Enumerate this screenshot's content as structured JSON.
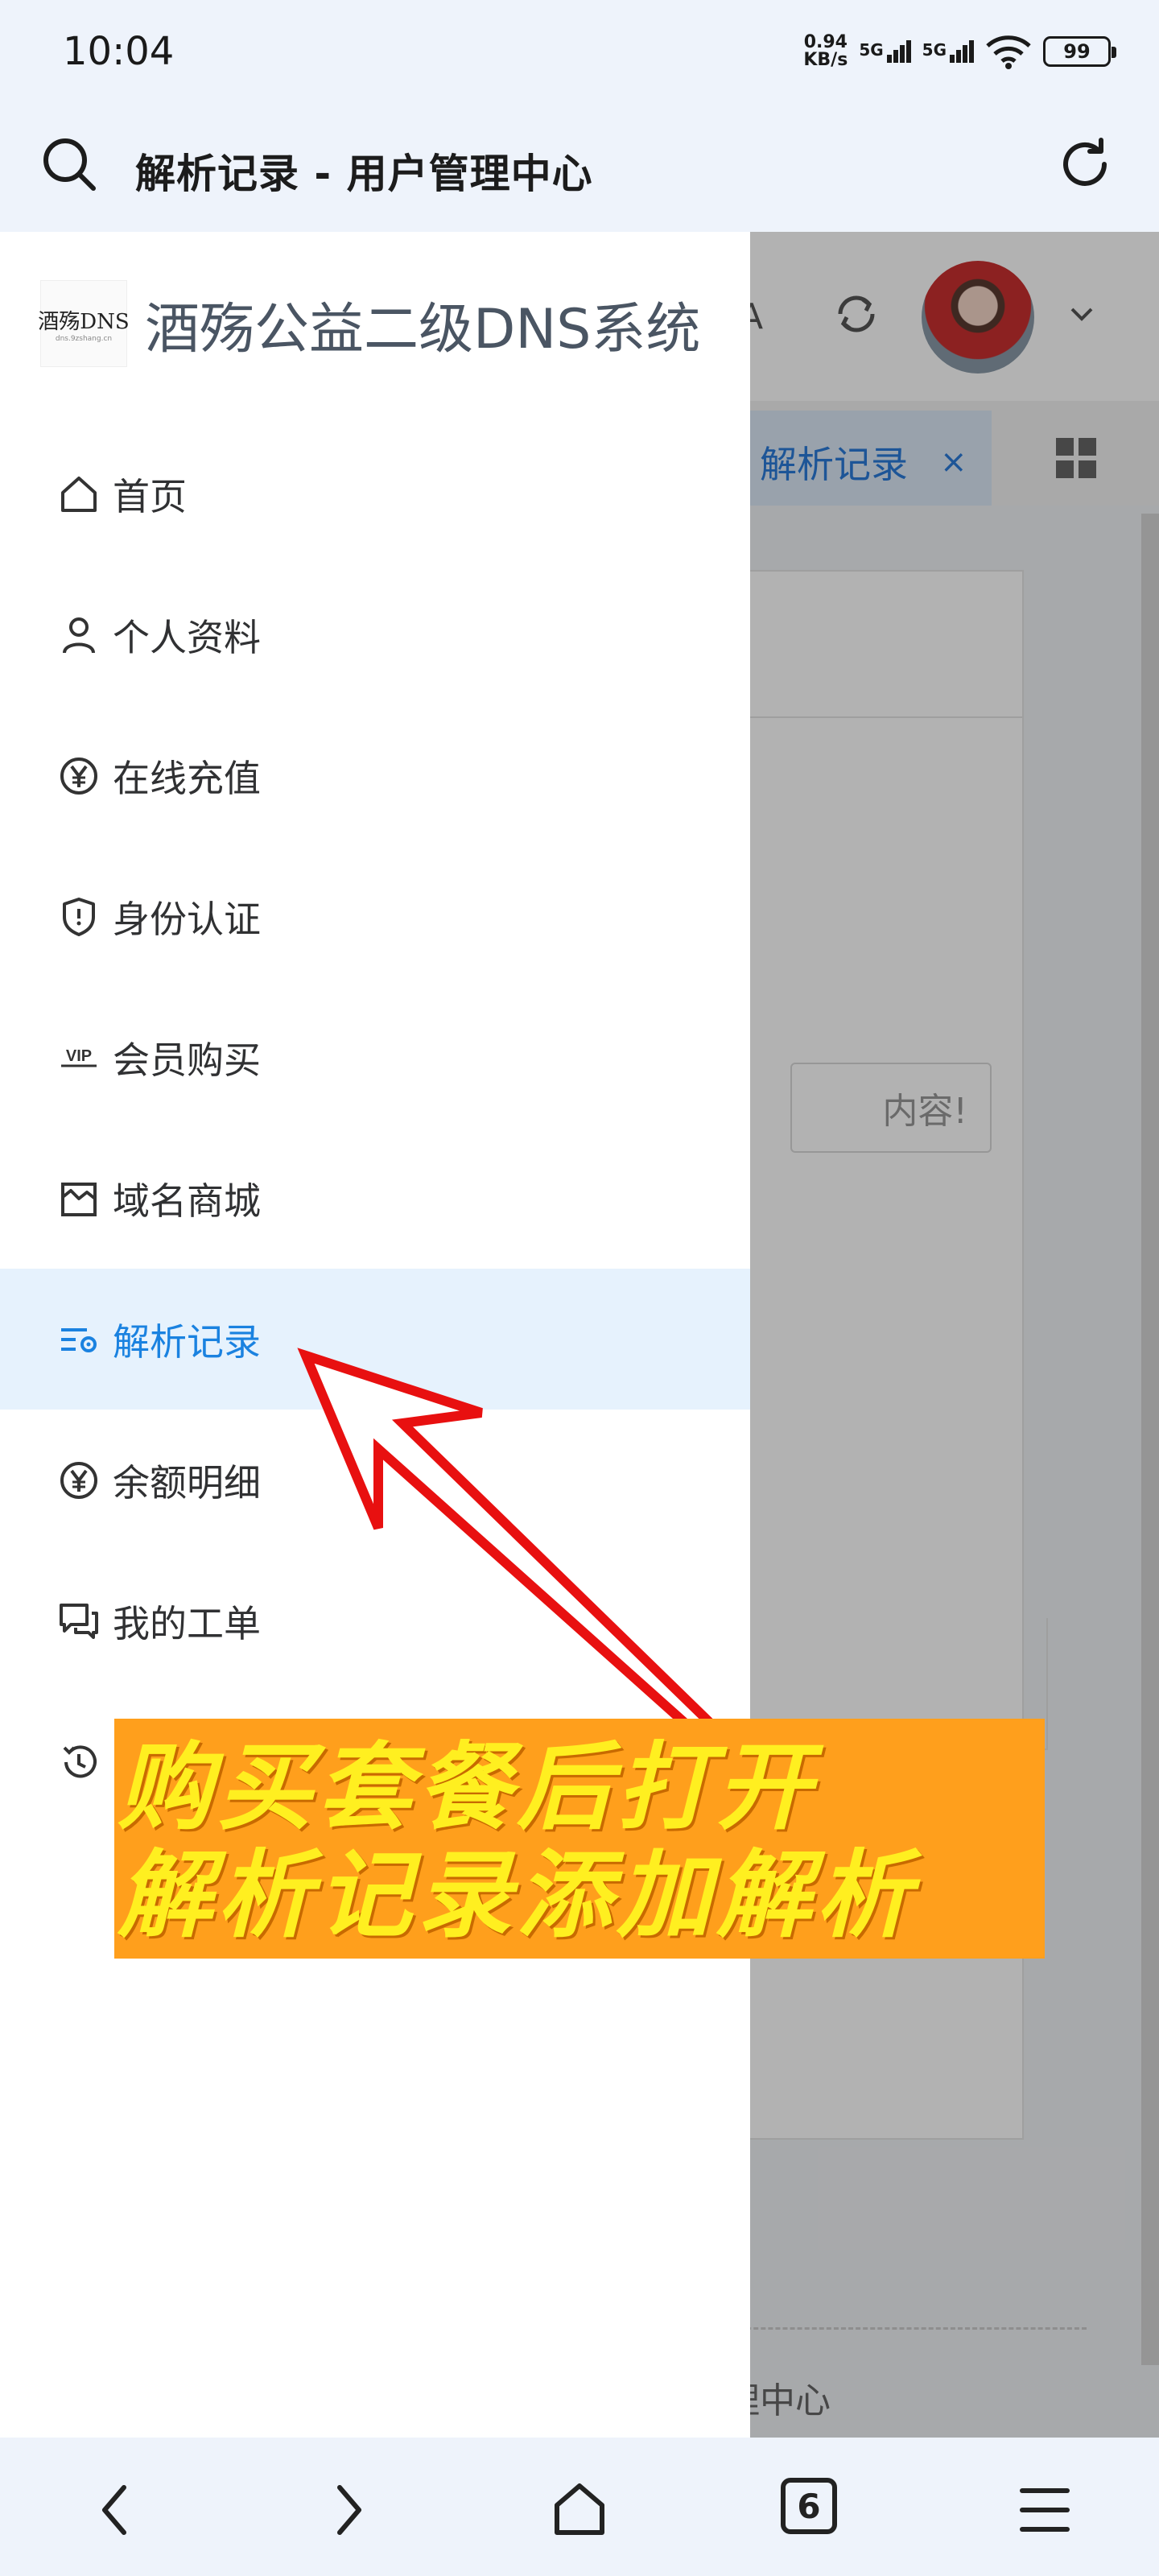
{
  "status_bar": {
    "time": "10:04",
    "net_speed_value": "0.94",
    "net_speed_unit": "KB/s",
    "signal1_label": "5G",
    "signal2_label": "5G",
    "battery": "99"
  },
  "title_bar": {
    "title": "解析记录 - 用户管理中心",
    "left_icon": "search-icon",
    "right_icon": "refresh-icon"
  },
  "background_page": {
    "translate_glyph": "A",
    "active_tab_label": "解析记录",
    "active_tab_close": "×",
    "input_placeholder_fragment": "内容!",
    "pager": "‹ ›",
    "footer_fragment": "理中心"
  },
  "drawer": {
    "brand_logo_main": "酒殇DNS",
    "brand_logo_sub": "dns.9zshang.cn",
    "brand_name": "酒殇公益二级DNS系统",
    "menu": [
      {
        "label": "首页",
        "icon": "home-icon",
        "active": false
      },
      {
        "label": "个人资料",
        "icon": "user-icon",
        "active": false
      },
      {
        "label": "在线充值",
        "icon": "yen-circle-icon",
        "active": false
      },
      {
        "label": "身份认证",
        "icon": "shield-icon",
        "active": false
      },
      {
        "label": "会员购买",
        "icon": "vip-icon",
        "active": false
      },
      {
        "label": "域名商城",
        "icon": "shop-icon",
        "active": false
      },
      {
        "label": "解析记录",
        "icon": "records-settings-icon",
        "active": true
      },
      {
        "label": "余额明细",
        "icon": "yen-circle-icon",
        "active": false
      },
      {
        "label": "我的工单",
        "icon": "chat-icon",
        "active": false
      },
      {
        "label": "",
        "icon": "history-icon",
        "active": false
      }
    ]
  },
  "annotation": {
    "line1": "购买套餐后打开",
    "line2": "解析记录添加解析"
  },
  "bottom_nav": {
    "tab_count": "6"
  },
  "colors": {
    "accent": "#1a82e0",
    "active_bg": "#e6f2fd",
    "banner_bg": "#ff9f1c",
    "banner_text": "#ffef20",
    "arrow": "#e81010"
  }
}
